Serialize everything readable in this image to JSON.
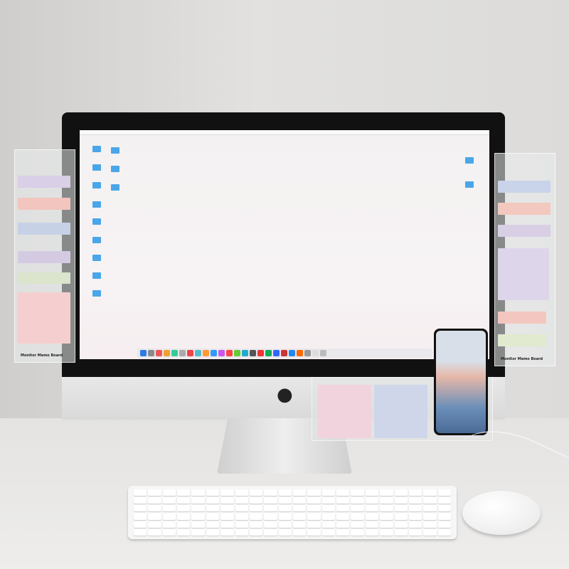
{
  "left_board": {
    "brand": "Monitor Memo Board",
    "note_colors": [
      "#d9cfe6",
      "#f2c5bf",
      "#c7d1e6",
      "#d4cbe3",
      "#dbe4cc",
      "#f5cfcf"
    ]
  },
  "right_board": {
    "brand": "Monitor Memo Board",
    "note_colors": [
      "#c9d3e9",
      "#f3c8be",
      "#d8cfe5",
      "#ddd6ea",
      "#f4c6c0",
      "#e1e9cf"
    ]
  },
  "phone_holder": {
    "note_colors": [
      "#f0d3dd",
      "#cfd6ea"
    ]
  },
  "dock_colors": [
    "#2d7be5",
    "#8a8a8a",
    "#e55",
    "#f0a030",
    "#3c9",
    "#aaa",
    "#e44",
    "#5bc",
    "#f93",
    "#39f",
    "#c5e",
    "#f44",
    "#6c3",
    "#2ac",
    "#555",
    "#e33",
    "#1a5",
    "#36f",
    "#c33",
    "#28e",
    "#f60",
    "#999",
    "#ddd",
    "#bbb"
  ]
}
